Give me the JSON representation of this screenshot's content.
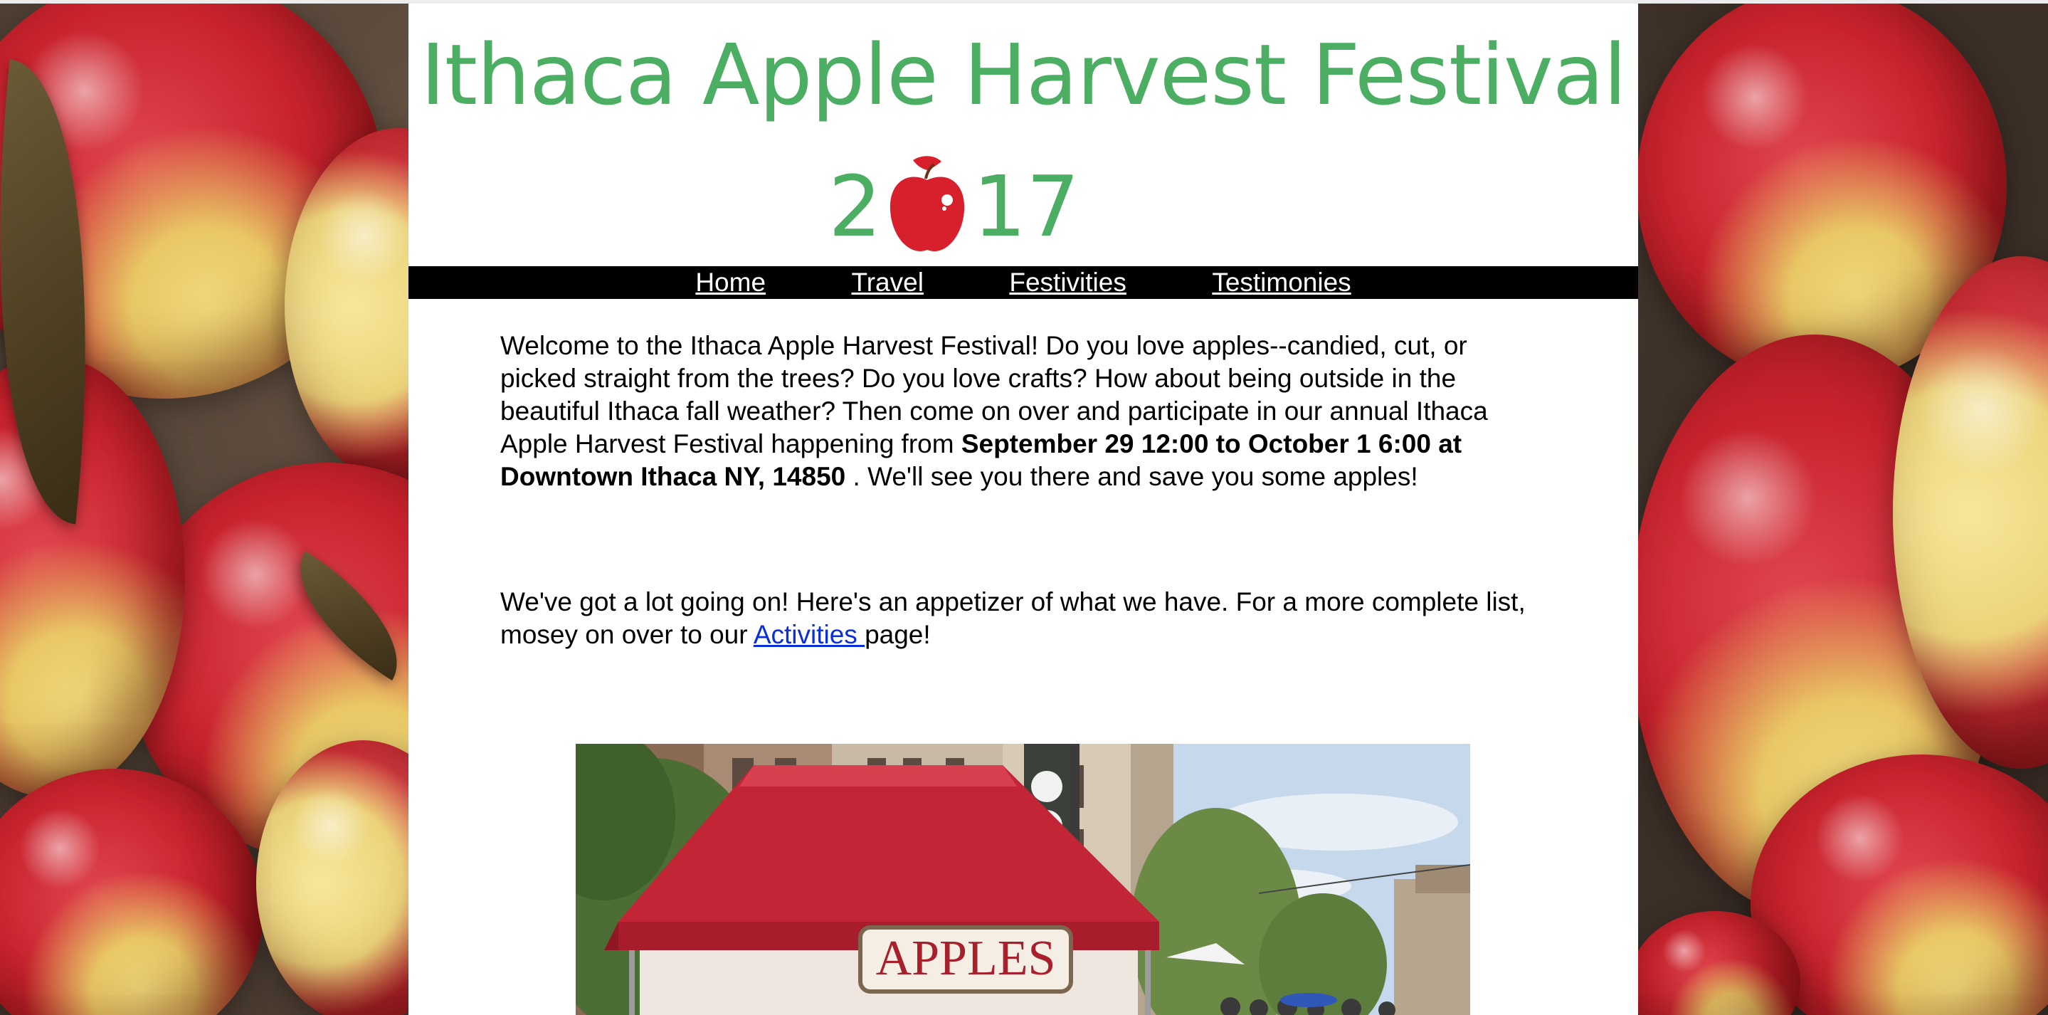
{
  "header": {
    "title": "Ithaca Apple Harvest Festival",
    "year_digit_1": "2",
    "year_digits_end": "17",
    "title_color": "#4cae63",
    "apple_logo_icon": "apple-icon"
  },
  "nav": {
    "items": [
      {
        "label": "Home "
      },
      {
        "label": "Travel "
      },
      {
        "label": "Festivities "
      },
      {
        "label": "Testimonies"
      }
    ]
  },
  "intro": {
    "text_before": "Welcome to the Ithaca Apple Harvest Festival! Do you love apples--candied, cut, or picked straight from the trees? Do you love crafts? How about being outside in the beautiful Ithaca fall weather? Then come on over and participate in our annual Ithaca Apple Harvest Festival happening from ",
    "dates_bold": "September 29 12:00 to October 1 6:00 at Downtown Ithaca NY, 14850",
    "text_after": " . We'll see you there and save you some apples!"
  },
  "activities_blurb": {
    "text_before": "We've got a lot going on! Here's an appetizer of what we have. For a more complete list, mosey on over to our ",
    "link_label": "Activities ",
    "text_after": "page!"
  },
  "photo": {
    "sign_text": "APPLES"
  },
  "colors": {
    "nav_bg": "#000000",
    "link": "#0b2fd6",
    "tent_red": "#c22636"
  }
}
